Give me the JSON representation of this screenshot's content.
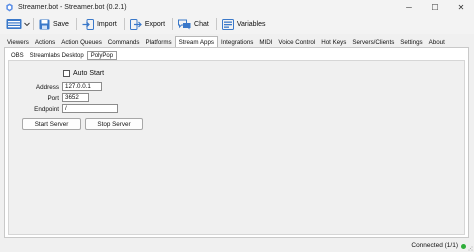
{
  "window": {
    "title": "Streamer.bot - Streamer.bot (0.2.1)",
    "controls": {
      "minimize": "─",
      "maximize": "☐",
      "close": "✕"
    }
  },
  "toolbar": {
    "items": [
      {
        "label": "Save",
        "icon": "save-icon"
      },
      {
        "label": "Import",
        "icon": "import-icon"
      },
      {
        "label": "Export",
        "icon": "export-icon"
      },
      {
        "label": "Chat",
        "icon": "chat-icon"
      },
      {
        "label": "Variables",
        "icon": "variables-icon"
      }
    ]
  },
  "tabs": [
    "Viewers",
    "Actions",
    "Action Queues",
    "Commands",
    "Platforms",
    "Stream Apps",
    "Integrations",
    "MIDI",
    "Voice Control",
    "Hot Keys",
    "Servers/Clients",
    "Settings",
    "About"
  ],
  "active_tab": "Stream Apps",
  "subtabs": [
    "OBS",
    "Streamlabs Desktop",
    "PolyPop"
  ],
  "active_subtab": "PolyPop",
  "polypop": {
    "auto_start_label": "Auto Start",
    "address_label": "Address",
    "address_value": "127.0.0.1",
    "port_label": "Port",
    "port_value": "3652",
    "endpoint_label": "Endpoint",
    "endpoint_value": "/",
    "start_button": "Start Server",
    "stop_button": "Stop Server"
  },
  "status": {
    "text": "Connected (1/1)",
    "dot_color": "#2fae3a"
  },
  "colors": {
    "toolbar_icon_blue": "#3a78c9",
    "window_bg": "#f0f0f0"
  }
}
